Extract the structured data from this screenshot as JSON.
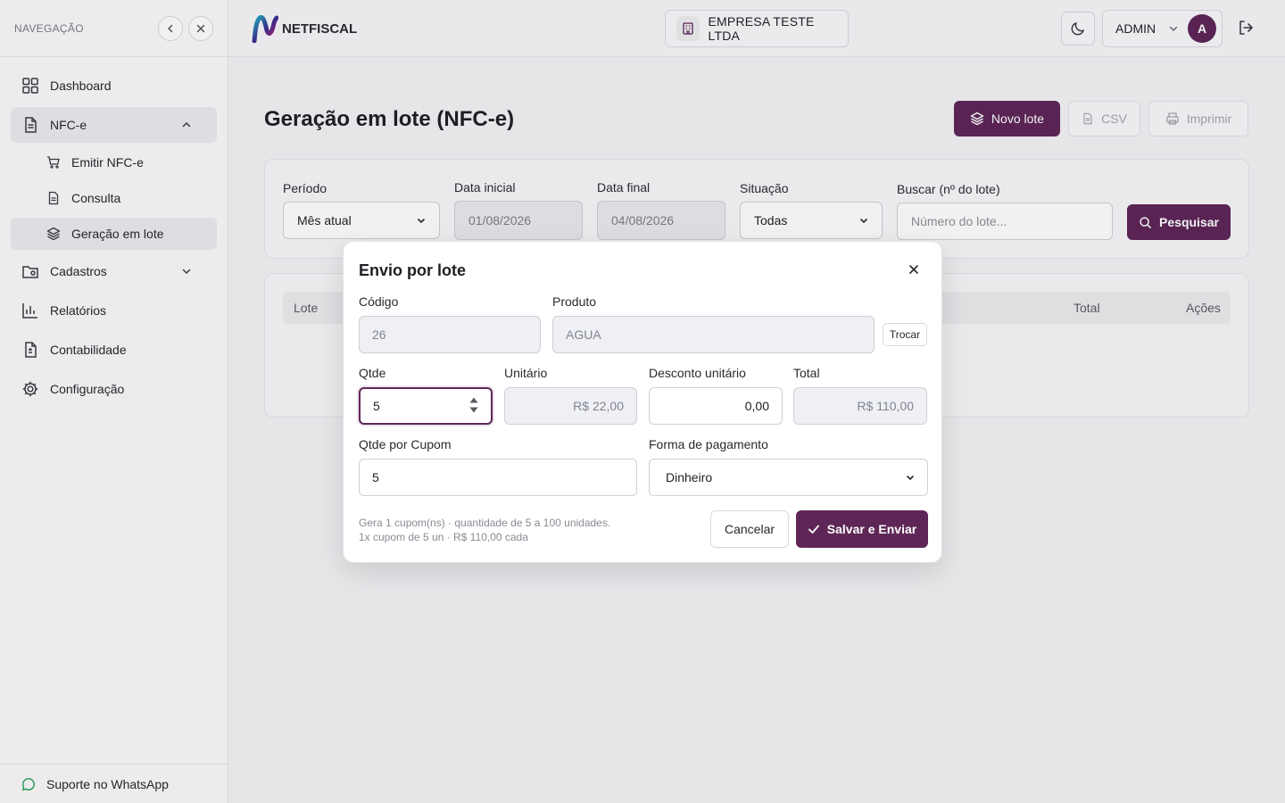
{
  "sidebar": {
    "title": "NAVEGAÇÃO",
    "items": [
      {
        "label": "Dashboard",
        "icon": "dashboard-icon"
      },
      {
        "label": "NFC-e",
        "icon": "document-icon"
      },
      {
        "label": "Cadastros",
        "icon": "folder-icon"
      },
      {
        "label": "Relatórios",
        "icon": "chart-icon"
      },
      {
        "label": "Contabilidade",
        "icon": "calculator-icon"
      },
      {
        "label": "Configuração",
        "icon": "gear-icon"
      }
    ],
    "nfce_subitems": [
      {
        "label": "Emitir NFC-e",
        "icon": "cart-icon"
      },
      {
        "label": "Consulta",
        "icon": "file-icon"
      },
      {
        "label": "Geração em lote",
        "icon": "layers-icon"
      }
    ],
    "footer": "Suporte no WhatsApp"
  },
  "header": {
    "logo_net": "NET",
    "logo_fiscal": "FISCAL",
    "company": "EMPRESA TESTE LTDA",
    "user": "ADMIN",
    "avatar_initial": "A"
  },
  "page": {
    "title": "Geração em lote (NFC-e)",
    "actions": {
      "new_batch": "Novo lote",
      "csv": "CSV",
      "print": "Imprimir"
    }
  },
  "filters": {
    "period_label": "Período",
    "period_value": "Mês atual",
    "start_label": "Data inicial",
    "start_value": "01/08/2026",
    "end_label": "Data final",
    "end_value": "04/08/2026",
    "status_label": "Situação",
    "status_value": "Todas",
    "search_label": "Buscar (nº do lote)",
    "search_placeholder": "Número do lote...",
    "search_button": "Pesquisar"
  },
  "table": {
    "columns": [
      "Lote",
      "Total",
      "Ações"
    ]
  },
  "modal": {
    "title": "Envio por lote",
    "code_label": "Código",
    "code_value": "26",
    "product_label": "Produto",
    "product_value": "AGUA",
    "swap_button": "Trocar",
    "qty_label": "Qtde",
    "qty_value": "5",
    "unit_label": "Unitário",
    "unit_value": "R$ 22,00",
    "discount_label": "Desconto unitário",
    "discount_value": "0,00",
    "total_label": "Total",
    "total_value": "R$ 110,00",
    "qty_per_coupon_label": "Qtde por Cupom",
    "qty_per_coupon_value": "5",
    "payment_label": "Forma de pagamento",
    "payment_value": "Dinheiro",
    "hint_line1": "Gera 1 cupom(ns) · quantidade de 5 a 100 unidades.",
    "hint_line2": "1x cupom de 5 un · R$ 110,00 cada",
    "cancel_button": "Cancelar",
    "save_button": "Salvar e Enviar"
  },
  "colors": {
    "primary": "#5e2657",
    "whatsapp": "#25a05a"
  }
}
